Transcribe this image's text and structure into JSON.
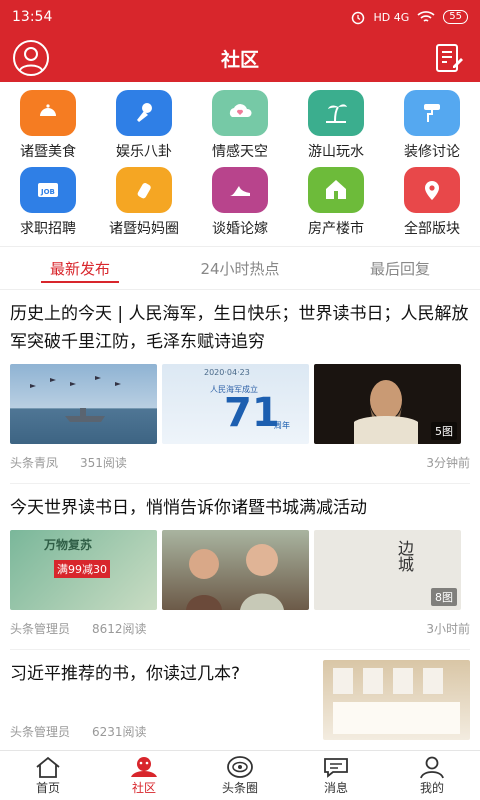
{
  "status": {
    "time": "13:54",
    "network": "HD 4G",
    "battery": "55"
  },
  "header": {
    "title": "社区"
  },
  "categories": [
    {
      "label": "诸暨美食",
      "icon": "food-cloche-icon",
      "color": "#f57c22"
    },
    {
      "label": "娱乐八卦",
      "icon": "microphone-icon",
      "color": "#2f7fe6"
    },
    {
      "label": "情感天空",
      "icon": "heart-cloud-icon",
      "color": "#76c9a6"
    },
    {
      "label": "游山玩水",
      "icon": "palm-island-icon",
      "color": "#3bae8e"
    },
    {
      "label": "装修讨论",
      "icon": "paint-roller-icon",
      "color": "#55a8f0"
    },
    {
      "label": "求职招聘",
      "icon": "job-briefcase-icon",
      "color": "#2f7fe6"
    },
    {
      "label": "诸暨妈妈圈",
      "icon": "baby-bottle-icon",
      "color": "#f5a623"
    },
    {
      "label": "谈婚论嫁",
      "icon": "high-heel-icon",
      "color": "#b8448c"
    },
    {
      "label": "房产楼市",
      "icon": "house-icon",
      "color": "#6dbb3a"
    },
    {
      "label": "全部版块",
      "icon": "location-pin-icon",
      "color": "#e8484a"
    }
  ],
  "tabs": [
    {
      "label": "最新发布"
    },
    {
      "label": "24小时热点"
    },
    {
      "label": "最后回复"
    }
  ],
  "posts": [
    {
      "title": "历史上的今天 | 人民海军，生日快乐；世界读书日；人民解放军突破千里江防，毛泽东赋诗追穷",
      "author": "头条青凤",
      "reads": "351阅读",
      "time": "3分钟前",
      "image_count": "5图",
      "thumb_text": [
        "2020·04·23",
        "人民海军成立",
        "71",
        "周年"
      ]
    },
    {
      "title": "今天世界读书日，悄悄告诉你诸暨书城满减活动",
      "author": "头条管理员",
      "reads": "8612阅读",
      "time": "3小时前",
      "image_count": "8图",
      "thumb_text": [
        "万物复苏",
        "满99减30",
        "边城"
      ]
    },
    {
      "title": "习近平推荐的书，你读过几本?",
      "author": "头条管理员",
      "reads": "6231阅读",
      "time": ""
    }
  ],
  "bottom_nav": [
    {
      "label": "首页",
      "icon": "home-icon"
    },
    {
      "label": "社区",
      "icon": "community-icon"
    },
    {
      "label": "头条圈",
      "icon": "eye-circle-icon"
    },
    {
      "label": "消息",
      "icon": "message-bubble-icon"
    },
    {
      "label": "我的",
      "icon": "user-icon"
    }
  ],
  "colors": {
    "brand": "#d8262c",
    "muted": "#999999"
  }
}
